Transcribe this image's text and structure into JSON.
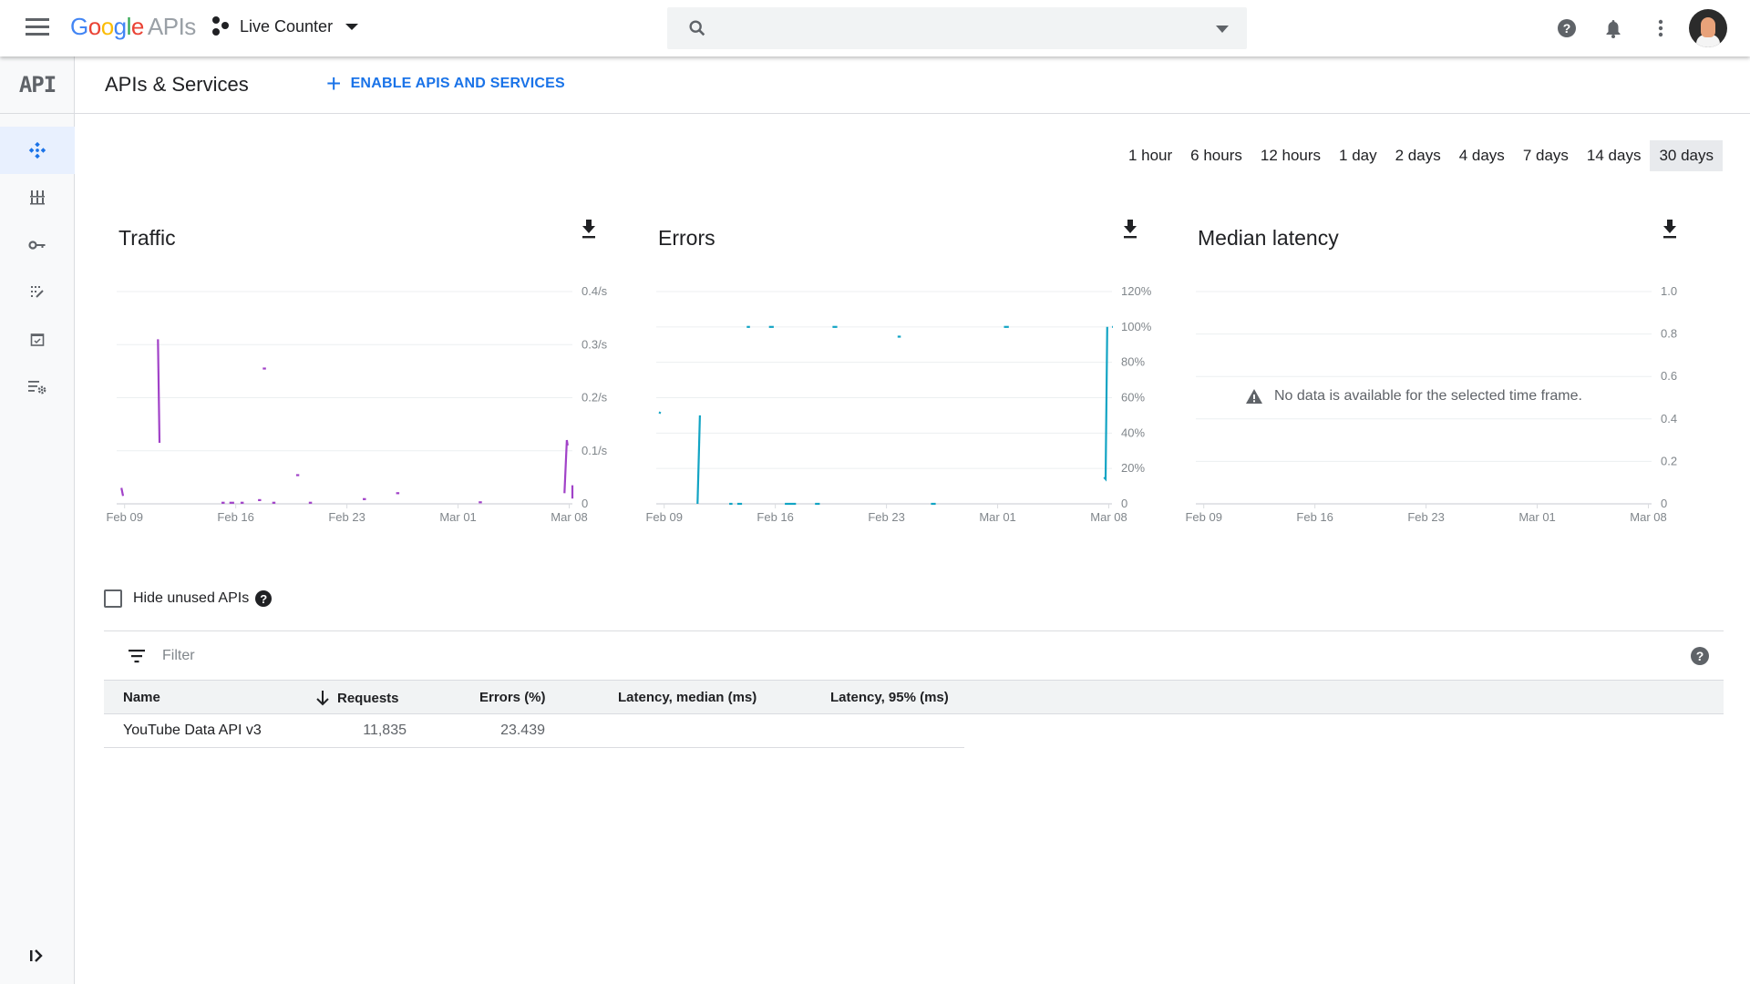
{
  "header": {
    "logo_google": [
      "G",
      "o",
      "o",
      "g",
      "l",
      "e"
    ],
    "logo_suffix": "APIs",
    "project_name": "Live Counter",
    "search_placeholder": "",
    "icons": [
      "menu-icon",
      "search-icon",
      "help-icon",
      "notifications-icon",
      "more-vert-icon",
      "avatar"
    ]
  },
  "sidebar": {
    "badge": "API",
    "items": [
      {
        "name": "dashboard",
        "icon": "dashboard-icon",
        "active": true
      },
      {
        "name": "library",
        "icon": "library-icon",
        "active": false
      },
      {
        "name": "credentials",
        "icon": "key-icon",
        "active": false
      },
      {
        "name": "oauth-consent",
        "icon": "consent-icon",
        "active": false
      },
      {
        "name": "domain-verification",
        "icon": "verify-icon",
        "active": false
      },
      {
        "name": "page-usage-agreements",
        "icon": "settings-list-icon",
        "active": false
      }
    ]
  },
  "subheader": {
    "title": "APIs & Services",
    "enable_button": "ENABLE APIS AND SERVICES",
    "accent_color": "#1a73e8"
  },
  "time_ranges": {
    "options": [
      "1 hour",
      "6 hours",
      "12 hours",
      "1 day",
      "2 days",
      "4 days",
      "7 days",
      "14 days",
      "30 days"
    ],
    "selected": "30 days"
  },
  "chart_data": [
    {
      "type": "line",
      "title": "Traffic",
      "color": "#a142c8",
      "x_ticks": [
        "Feb 09",
        "Feb 16",
        "Feb 23",
        "Mar 01",
        "Mar 08"
      ],
      "y_ticks": [
        "0",
        "0.1/s",
        "0.2/s",
        "0.3/s",
        "0.4/s"
      ],
      "ylim": [
        0,
        0.4
      ],
      "xlim_days": [
        -0.5,
        28.2
      ],
      "segments": [
        [
          [
            -0.2,
            0.03
          ],
          [
            -0.1,
            0.015
          ]
        ],
        [
          [
            2.1,
            0.31
          ],
          [
            2.2,
            0.115
          ]
        ],
        [
          [
            6.1,
            0.002
          ],
          [
            6.3,
            0.002
          ]
        ],
        [
          [
            6.6,
            0.002
          ],
          [
            6.9,
            0.002
          ]
        ],
        [
          [
            7.3,
            0.002
          ],
          [
            7.5,
            0.002
          ]
        ],
        [
          [
            8.4,
            0.007
          ],
          [
            8.6,
            0.007
          ]
        ],
        [
          [
            8.7,
            0.255
          ],
          [
            8.9,
            0.255
          ]
        ],
        [
          [
            9.3,
            0.002
          ],
          [
            9.5,
            0.002
          ]
        ],
        [
          [
            10.8,
            0.054
          ],
          [
            11.0,
            0.054
          ]
        ],
        [
          [
            11.6,
            0.002
          ],
          [
            11.8,
            0.002
          ]
        ],
        [
          [
            15.0,
            0.009
          ],
          [
            15.2,
            0.009
          ]
        ],
        [
          [
            17.1,
            0.02
          ],
          [
            17.3,
            0.02
          ]
        ],
        [
          [
            22.3,
            0.003
          ],
          [
            22.5,
            0.003
          ]
        ],
        [
          [
            27.7,
            0.02
          ],
          [
            27.85,
            0.12
          ],
          [
            27.9,
            0.11
          ]
        ],
        [
          [
            28.2,
            0.035
          ],
          [
            28.2,
            0.01
          ]
        ]
      ]
    },
    {
      "type": "line",
      "title": "Errors",
      "color": "#12a4c4",
      "x_ticks": [
        "Feb 09",
        "Feb 16",
        "Feb 23",
        "Mar 01",
        "Mar 08"
      ],
      "y_ticks": [
        "0",
        "20%",
        "40%",
        "60%",
        "80%",
        "100%",
        "120%"
      ],
      "ylim": [
        0,
        120
      ],
      "xlim_days": [
        -0.5,
        28.2
      ],
      "segments": [
        [
          [
            -0.3,
            51
          ],
          [
            -0.25,
            52
          ]
        ],
        [
          [
            2.1,
            0
          ],
          [
            2.25,
            50
          ]
        ],
        [
          [
            4.1,
            0
          ],
          [
            4.3,
            0
          ]
        ],
        [
          [
            4.6,
            0
          ],
          [
            4.9,
            0
          ]
        ],
        [
          [
            5.2,
            100
          ],
          [
            5.4,
            100
          ]
        ],
        [
          [
            6.6,
            100
          ],
          [
            6.9,
            100
          ]
        ],
        [
          [
            7.6,
            0
          ],
          [
            8.3,
            0
          ]
        ],
        [
          [
            9.5,
            0
          ],
          [
            9.8,
            0
          ]
        ],
        [
          [
            10.6,
            100
          ],
          [
            10.9,
            100
          ]
        ],
        [
          [
            14.7,
            94.5
          ],
          [
            14.9,
            94.5
          ]
        ],
        [
          [
            16.8,
            0
          ],
          [
            17.1,
            0
          ]
        ],
        [
          [
            21.4,
            100
          ],
          [
            21.7,
            100
          ]
        ],
        [
          [
            27.7,
            15
          ],
          [
            27.8,
            14
          ],
          [
            27.9,
            100
          ]
        ],
        [
          [
            28.2,
            100
          ],
          [
            28.25,
            100
          ]
        ]
      ]
    },
    {
      "type": "line",
      "title": "Median latency",
      "color": "#5f6368",
      "x_ticks": [
        "Feb 09",
        "Feb 16",
        "Feb 23",
        "Mar 01",
        "Mar 08"
      ],
      "y_ticks": [
        "0",
        "0.2",
        "0.4",
        "0.6",
        "0.8",
        "1.0"
      ],
      "ylim": [
        0,
        1.0
      ],
      "xlim_days": [
        -0.5,
        28.2
      ],
      "segments": [],
      "no_data_message": "No data is available for the selected time frame."
    }
  ],
  "hide_unused": {
    "label": "Hide unused APIs",
    "checked": false,
    "help": "?"
  },
  "filter": {
    "placeholder": "Filter",
    "help": "?"
  },
  "table": {
    "columns": [
      "Name",
      "Requests",
      "Errors (%)",
      "Latency, median (ms)",
      "Latency, 95% (ms)"
    ],
    "sort_column": "Requests",
    "sort_direction": "descending",
    "rows": [
      {
        "name": "YouTube Data API v3",
        "requests": "11,835",
        "errors": "23.439",
        "latency_median": "",
        "latency_95": ""
      }
    ]
  }
}
